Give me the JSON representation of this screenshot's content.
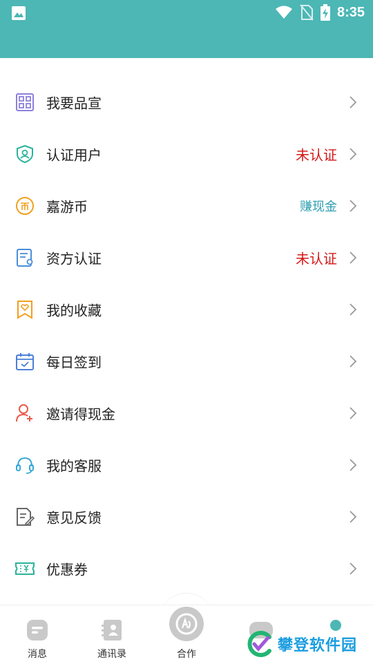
{
  "status_bar": {
    "time": "8:35",
    "left_icon": "image-icon",
    "right_icons": [
      "wifi-icon",
      "no-sim-icon",
      "battery-charging-icon"
    ]
  },
  "menu": [
    {
      "label": "我要品宣",
      "icon": "grid-icon",
      "extra": ""
    },
    {
      "label": "认证用户",
      "icon": "shield-user-icon",
      "extra": "未认证"
    },
    {
      "label": "嘉游币",
      "icon": "coin-icon",
      "extra": "赚现金"
    },
    {
      "label": "资方认证",
      "icon": "certificate-icon",
      "extra": "未认证"
    },
    {
      "label": "我的收藏",
      "icon": "heart-bookmark-icon",
      "extra": ""
    },
    {
      "label": "每日签到",
      "icon": "calendar-check-icon",
      "extra": ""
    },
    {
      "label": "邀请得现金",
      "icon": "user-add-icon",
      "extra": ""
    },
    {
      "label": "我的客服",
      "icon": "headset-icon",
      "extra": ""
    },
    {
      "label": "意见反馈",
      "icon": "feedback-doc-icon",
      "extra": ""
    },
    {
      "label": "优惠券",
      "icon": "ticket-icon",
      "extra": ""
    }
  ],
  "tabbar": {
    "tabs": [
      {
        "label": "消息"
      },
      {
        "label": "通讯录"
      },
      {
        "label": "合作"
      }
    ]
  },
  "watermark": {
    "text": "攀登软件园"
  },
  "colors": {
    "header": "#4cb7b5",
    "alert_red": "#d41a1a",
    "link_teal": "#2f9fb0"
  }
}
